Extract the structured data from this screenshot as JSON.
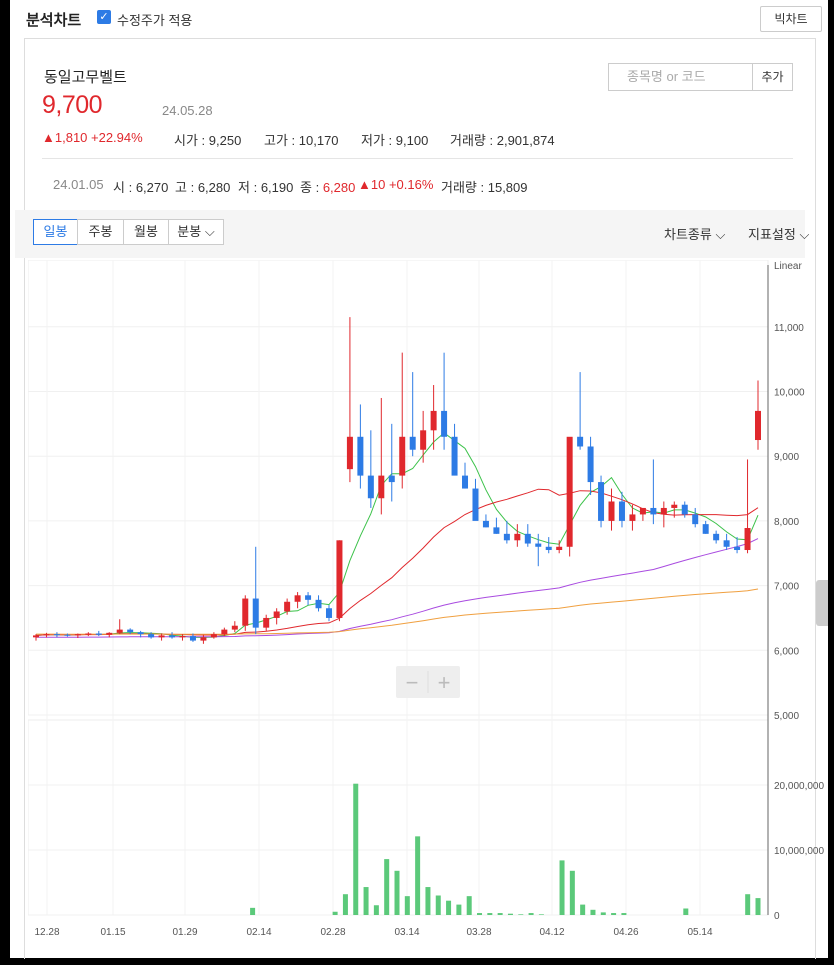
{
  "app": {
    "title": "분석차트",
    "checkbox_label": "수정주가 적용",
    "big_button": "빅차트"
  },
  "stock": {
    "name": "동일고무벨트",
    "price": "9,700",
    "date": "24.05.28",
    "change": "▲1,810 +22.94%",
    "open_label": "시가",
    "open": "9,250",
    "high_label": "고가",
    "high": "10,170",
    "low_label": "저가",
    "low": "9,100",
    "volume_label": "거래량",
    "volume": "2,901,874"
  },
  "search": {
    "placeholder": "종목명 or 코드",
    "add_label": "추가"
  },
  "history": {
    "date": "24.01.05",
    "open_label": "시",
    "open": "6,270",
    "high_label": "고",
    "high": "6,280",
    "low_label": "저",
    "low": "6,190",
    "close_label": "종",
    "close": "6,280",
    "change": "▲10 +0.16%",
    "volume_label": "거래량",
    "volume": "15,809"
  },
  "tabs": [
    "일봉",
    "주봉",
    "월봉",
    "분봉 ⌵"
  ],
  "dropdowns": {
    "chart_type": "차트종류 ⌵",
    "indicator": "지표설정 ⌵"
  },
  "zoom": {
    "minus": "−",
    "plus": "+"
  },
  "colors": {
    "up": "#e0282d",
    "down": "#2d7be5",
    "volume": "#5bc97a",
    "ma5": "#3cc24a",
    "ma20": "#e0282d",
    "ma60": "#a94be0",
    "ma120": "#f0a040"
  },
  "chart_data": {
    "type": "candlestick",
    "scale_label": "Linear",
    "price_ticks": [
      "11,000",
      "10,000",
      "9,000",
      "8,000",
      "7,000",
      "6,000",
      "5,000"
    ],
    "volume_ticks": [
      "20,000,000",
      "10,000,000",
      "0"
    ],
    "x_ticks": [
      "12.28",
      "01.15",
      "01.29",
      "02.14",
      "02.28",
      "03.14",
      "03.28",
      "04.12",
      "04.26",
      "05.14"
    ],
    "ylim": [
      5000,
      11500
    ],
    "candles": [
      [
        6200,
        6250,
        6150,
        6230
      ],
      [
        6230,
        6270,
        6200,
        6250
      ],
      [
        6250,
        6280,
        6200,
        6240
      ],
      [
        6240,
        6260,
        6210,
        6230
      ],
      [
        6230,
        6260,
        6190,
        6250
      ],
      [
        6250,
        6280,
        6220,
        6260
      ],
      [
        6260,
        6300,
        6220,
        6240
      ],
      [
        6240,
        6280,
        6200,
        6270
      ],
      [
        6270,
        6480,
        6250,
        6320
      ],
      [
        6320,
        6340,
        6250,
        6280
      ],
      [
        6280,
        6300,
        6200,
        6250
      ],
      [
        6250,
        6280,
        6180,
        6200
      ],
      [
        6200,
        6260,
        6150,
        6230
      ],
      [
        6230,
        6280,
        6180,
        6200
      ],
      [
        6200,
        6250,
        6150,
        6220
      ],
      [
        6220,
        6260,
        6130,
        6150
      ],
      [
        6150,
        6240,
        6100,
        6200
      ],
      [
        6200,
        6280,
        6180,
        6250
      ],
      [
        6250,
        6350,
        6220,
        6320
      ],
      [
        6320,
        6450,
        6280,
        6380
      ],
      [
        6380,
        6850,
        6300,
        6800
      ],
      [
        6800,
        7600,
        6250,
        6350
      ],
      [
        6350,
        6550,
        6300,
        6500
      ],
      [
        6500,
        6650,
        6400,
        6600
      ],
      [
        6600,
        6800,
        6550,
        6750
      ],
      [
        6750,
        6900,
        6650,
        6850
      ],
      [
        6850,
        6900,
        6700,
        6780
      ],
      [
        6780,
        6850,
        6600,
        6650
      ],
      [
        6650,
        6700,
        6450,
        6500
      ],
      [
        6500,
        7700,
        6450,
        7700
      ],
      [
        8800,
        11150,
        8600,
        9300
      ],
      [
        9300,
        9800,
        8500,
        8700
      ],
      [
        8700,
        9400,
        8200,
        8350
      ],
      [
        8350,
        9900,
        8100,
        8700
      ],
      [
        8700,
        9500,
        8300,
        8600
      ],
      [
        8700,
        10600,
        8500,
        9300
      ],
      [
        9300,
        10300,
        9000,
        9100
      ],
      [
        9100,
        9700,
        8900,
        9400
      ],
      [
        9400,
        10100,
        9100,
        9700
      ],
      [
        9700,
        10600,
        9100,
        9300
      ],
      [
        9300,
        9500,
        8900,
        8700
      ],
      [
        8700,
        8900,
        8500,
        8500
      ],
      [
        8500,
        8650,
        8200,
        8000
      ],
      [
        8000,
        8100,
        7900,
        7900
      ],
      [
        7900,
        8050,
        7800,
        7800
      ],
      [
        7800,
        8000,
        7650,
        7700
      ],
      [
        7700,
        7950,
        7600,
        7800
      ],
      [
        7800,
        7950,
        7600,
        7650
      ],
      [
        7650,
        7800,
        7300,
        7600
      ],
      [
        7600,
        7750,
        7500,
        7550
      ],
      [
        7550,
        7700,
        7500,
        7600
      ],
      [
        7600,
        7800,
        7450,
        9300
      ],
      [
        9300,
        10300,
        9100,
        9150
      ],
      [
        9150,
        9300,
        8400,
        8600
      ],
      [
        8600,
        8700,
        7900,
        8000
      ],
      [
        8000,
        8500,
        7850,
        8300
      ],
      [
        8300,
        8450,
        7900,
        8000
      ],
      [
        8000,
        8250,
        7850,
        8100
      ],
      [
        8100,
        8200,
        8000,
        8200
      ],
      [
        8200,
        8950,
        7950,
        8100
      ],
      [
        8100,
        8300,
        7900,
        8200
      ],
      [
        8200,
        8300,
        8050,
        8250
      ],
      [
        8250,
        8300,
        8050,
        8100
      ],
      [
        8100,
        8200,
        7900,
        7950
      ],
      [
        7950,
        8000,
        7800,
        7800
      ],
      [
        7800,
        7850,
        7650,
        7700
      ],
      [
        7700,
        7800,
        7550,
        7600
      ],
      [
        7600,
        7750,
        7500,
        7550
      ],
      [
        7550,
        8950,
        7500,
        7890
      ],
      [
        9250,
        10170,
        9100,
        9700
      ]
    ],
    "volumes": [
      0,
      0,
      0,
      0,
      0,
      0,
      0,
      0,
      0,
      0,
      0,
      0,
      0,
      0,
      0,
      0,
      0,
      0,
      0,
      0,
      0,
      1100000,
      0,
      0,
      0,
      0,
      0,
      0,
      0,
      500000,
      3200000,
      20200000,
      4300000,
      1500000,
      8600000,
      6800000,
      2900000,
      12100000,
      4300000,
      3000000,
      2200000,
      1600000,
      2900000,
      300000,
      300000,
      300000,
      200000,
      100000,
      300000,
      100000,
      0,
      8400000,
      6800000,
      1600000,
      800000,
      400000,
      300000,
      300000,
      0,
      0,
      0,
      0,
      0,
      1000000,
      0,
      0,
      0,
      0,
      0,
      3200000,
      2600000
    ]
  }
}
